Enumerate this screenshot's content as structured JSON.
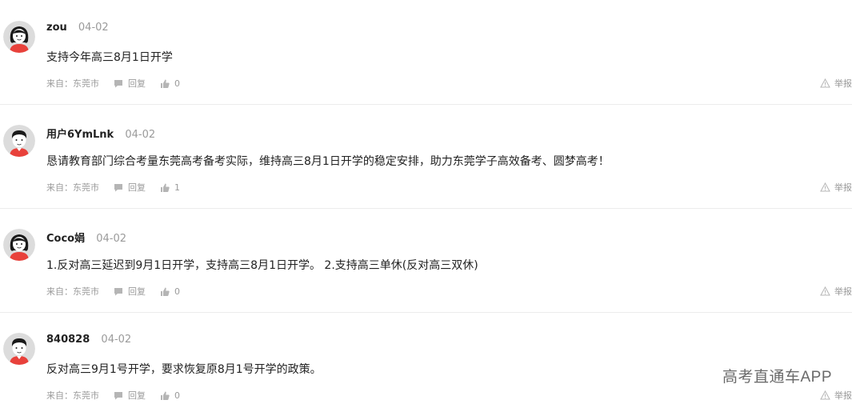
{
  "comments": [
    {
      "user": "zou",
      "date": "04-02",
      "avatar": "female-avatar",
      "content": "支持今年高三8月1日开学",
      "source": "来自：东莞市",
      "reply_label": "回复",
      "likes": "0",
      "report_label": "举报"
    },
    {
      "user": "用户6YmLnk",
      "date": "04-02",
      "avatar": "male-avatar",
      "content": "恳请教育部门综合考量东莞高考备考实际，维持高三8月1日开学的稳定安排，助力东莞学子高效备考、圆梦高考！",
      "source": "来自：东莞市",
      "reply_label": "回复",
      "likes": "1",
      "report_label": "举报"
    },
    {
      "user": "Coco娟",
      "date": "04-02",
      "avatar": "female-avatar",
      "content": "1.反对高三延迟到9月1日开学，支持高三8月1日开学。 2.支持高三单休(反对高三双休)",
      "source": "来自：东莞市",
      "reply_label": "回复",
      "likes": "0",
      "report_label": "举报"
    },
    {
      "user": "840828",
      "date": "04-02",
      "avatar": "male-avatar",
      "content": "反对高三9月1号开学，要求恢复原8月1号开学的政策。",
      "source": "来自：东莞市",
      "reply_label": "回复",
      "likes": "0",
      "report_label": "举报"
    }
  ],
  "watermark": "高考直通车APP",
  "colors": {
    "avatar_bg": "#dcdcdc",
    "shirt_red": "#e8413b",
    "hair": "#1a1a1a",
    "skin": "#ffffff",
    "meta_text": "#9a9a9a"
  }
}
